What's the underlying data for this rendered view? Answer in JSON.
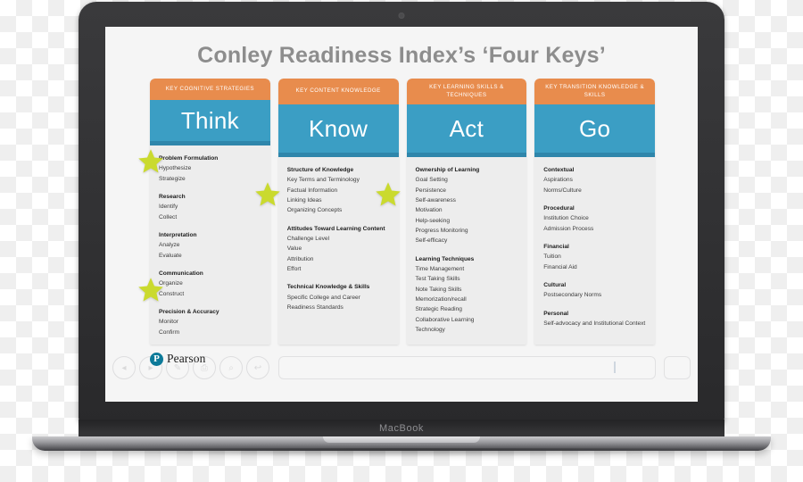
{
  "device": {
    "label": "MacBook",
    "camera_icon": "webcam-icon"
  },
  "slide": {
    "title": "Conley Readiness Index’s ‘Four Keys’",
    "brand": {
      "mark_letter": "P",
      "name": "Pearson"
    },
    "accent_colors": {
      "orange_header": "#e88c4d",
      "blue_header": "#3b9ec4",
      "blue_header_shadow": "#2f86ab",
      "star": "#cada2e",
      "title_gray": "#8d8d8d",
      "card_body": "#ededed",
      "pearson_teal": "#0d7a99"
    },
    "columns": [
      {
        "eyebrow": "KEY COGNITIVE STRATEGIES",
        "key": "Think",
        "groups": [
          {
            "title": "Problem Formulation",
            "items": [
              "Hypothesize",
              "Strategize"
            ]
          },
          {
            "title": "Research",
            "items": [
              "Identify",
              "Collect"
            ]
          },
          {
            "title": "Interpretation",
            "items": [
              "Analyze",
              "Evaluate"
            ]
          },
          {
            "title": "Communication",
            "items": [
              "Organize",
              "Construct"
            ]
          },
          {
            "title": "Precision & Accuracy",
            "items": [
              "Monitor",
              "Confirm"
            ]
          }
        ]
      },
      {
        "eyebrow": "KEY CONTENT KNOWLEDGE",
        "key": "Know",
        "groups": [
          {
            "title": "Structure of Knowledge",
            "items": [
              "Key Terms and Terminology",
              "Factual Information",
              "Linking Ideas",
              "Organizing Concepts"
            ]
          },
          {
            "title": "Attitudes Toward Learning Content",
            "items": [
              "Challenge Level",
              "Value",
              "Attribution",
              "Effort"
            ]
          },
          {
            "title": "Technical Knowledge & Skills",
            "items": [
              "Specific College and Career Readiness Standards"
            ]
          }
        ]
      },
      {
        "eyebrow": "KEY LEARNING SKILLS & TECHNIQUES",
        "key": "Act",
        "groups": [
          {
            "title": "Ownership of Learning",
            "items": [
              "Goal Setting",
              "Persistence",
              "Self-awareness",
              "Motivation",
              "Help-seeking",
              "Progress Monitoring",
              "Self-efficacy"
            ]
          },
          {
            "title": "Learning Techniques",
            "items": [
              "Time Management",
              "Test Taking Skills",
              "Note Taking Skills",
              "Memorization/recall",
              "Strategic Reading",
              "Collaborative Learning",
              "Technology"
            ]
          }
        ]
      },
      {
        "eyebrow": "KEY TRANSITION KNOWLEDGE & SKILLS",
        "key": "Go",
        "groups": [
          {
            "title": "Contextual",
            "items": [
              "Aspirations",
              "Norms/Culture"
            ]
          },
          {
            "title": "Procedural",
            "items": [
              "Institution Choice",
              "Admission Process"
            ]
          },
          {
            "title": "Financial",
            "items": [
              "Tuition",
              "Financial Aid"
            ]
          },
          {
            "title": "Cultural",
            "items": [
              "Postsecondary Norms"
            ]
          },
          {
            "title": "Personal",
            "items": [
              "Self-advocacy and Institutional Context"
            ]
          }
        ]
      }
    ],
    "markers": [
      {
        "name": "star-marker-problem-formulation"
      },
      {
        "name": "star-marker-communication"
      },
      {
        "name": "star-marker-attitudes"
      },
      {
        "name": "star-marker-motivation"
      }
    ],
    "ghost_toolbar": [
      {
        "name": "back-icon",
        "glyph": "◂"
      },
      {
        "name": "forward-icon",
        "glyph": "▸"
      },
      {
        "name": "pen-icon",
        "glyph": "✎"
      },
      {
        "name": "print-icon",
        "glyph": "⎙"
      },
      {
        "name": "zoom-icon",
        "glyph": "⌕"
      },
      {
        "name": "undo-icon",
        "glyph": "↩"
      }
    ]
  }
}
